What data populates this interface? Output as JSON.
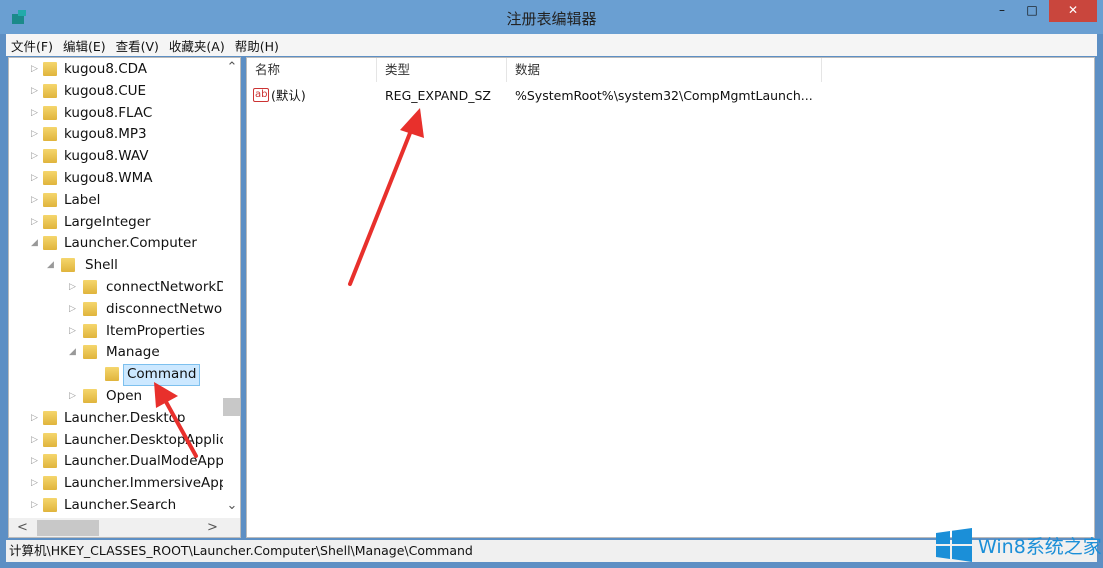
{
  "window": {
    "title": "注册表编辑器",
    "minimize": "–",
    "maximize": "□",
    "close": "✕"
  },
  "menu": [
    "文件(F)",
    "编辑(E)",
    "查看(V)",
    "收藏夹(A)",
    "帮助(H)"
  ],
  "tree": [
    {
      "label": "kugou8.CDA",
      "level": 0,
      "expander": "▷"
    },
    {
      "label": "kugou8.CUE",
      "level": 0,
      "expander": "▷"
    },
    {
      "label": "kugou8.FLAC",
      "level": 0,
      "expander": "▷"
    },
    {
      "label": "kugou8.MP3",
      "level": 0,
      "expander": "▷"
    },
    {
      "label": "kugou8.WAV",
      "level": 0,
      "expander": "▷"
    },
    {
      "label": "kugou8.WMA",
      "level": 0,
      "expander": "▷"
    },
    {
      "label": "Label",
      "level": 0,
      "expander": "▷"
    },
    {
      "label": "LargeInteger",
      "level": 0,
      "expander": "▷"
    },
    {
      "label": "Launcher.Computer",
      "level": 0,
      "expander": "◢"
    },
    {
      "label": "Shell",
      "level": 1,
      "expander": "◢"
    },
    {
      "label": "connectNetworkDrive",
      "level": 2,
      "expander": "▷"
    },
    {
      "label": "disconnectNetworkDrive",
      "level": 2,
      "expander": "▷"
    },
    {
      "label": "ItemProperties",
      "level": 2,
      "expander": "▷"
    },
    {
      "label": "Manage",
      "level": 2,
      "expander": "◢"
    },
    {
      "label": "Command",
      "level": 3,
      "expander": "",
      "selected": true
    },
    {
      "label": "Open",
      "level": 2,
      "expander": "▷"
    },
    {
      "label": "Launcher.Desktop",
      "level": 0,
      "expander": "▷"
    },
    {
      "label": "Launcher.DesktopApplication",
      "level": 0,
      "expander": "▷"
    },
    {
      "label": "Launcher.DualModeApplication",
      "level": 0,
      "expander": "▷"
    },
    {
      "label": "Launcher.ImmersiveApplication",
      "level": 0,
      "expander": "▷"
    },
    {
      "label": "Launcher.Search",
      "level": 0,
      "expander": "▷"
    }
  ],
  "scroll": {
    "up": "⌃",
    "down": "⌄",
    "left": "<",
    "right": ">"
  },
  "list": {
    "headers": [
      "名称",
      "类型",
      "数据"
    ],
    "rows": [
      {
        "name": "(默认)",
        "type": "REG_EXPAND_SZ",
        "data": "%SystemRoot%\\system32\\CompMgmtLaunch...",
        "icon": "ab-string-icon",
        "icon_text": "ab"
      }
    ]
  },
  "status": "计算机\\HKEY_CLASSES_ROOT\\Launcher.Computer\\Shell\\Manage\\Command",
  "watermark": "Win8系统之家",
  "colors": {
    "annotation_arrow": "#e8302c",
    "titlebar": "#6a9fd2",
    "selection": "#cce8ff"
  }
}
